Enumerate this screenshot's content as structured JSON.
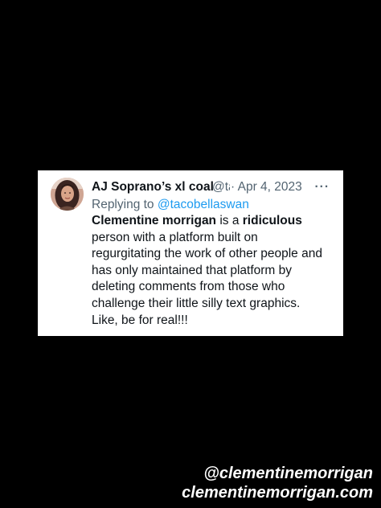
{
  "tweet": {
    "author_name": "AJ Soprano’s xl coal",
    "author_handle": "@tacobellaswan",
    "separator": "·",
    "date": "Apr 4, 2023",
    "more_icon": "more-horizontal-icon",
    "reply_prefix": "Replying to",
    "reply_mention": "@tacobellaswan",
    "body": {
      "bold_subject": "Clementine morrigan",
      "text_1": " is a ",
      "bold_word": "ridiculous",
      "line_2": "person with a platform built on",
      "line_3": "regurgitating the work of other people and",
      "line_4": "has only maintained that platform by",
      "line_5": "deleting comments from those who",
      "line_6": "challenge their little silly text graphics.",
      "line_7": "Like, be for real!!!"
    }
  },
  "watermark": {
    "handle": "@clementinemorrigan",
    "url": "clementinemorrigan.com"
  },
  "colors": {
    "background": "#000000",
    "card": "#ffffff",
    "text": "#0f1419",
    "secondary": "#536471",
    "link": "#1d9bf0"
  }
}
